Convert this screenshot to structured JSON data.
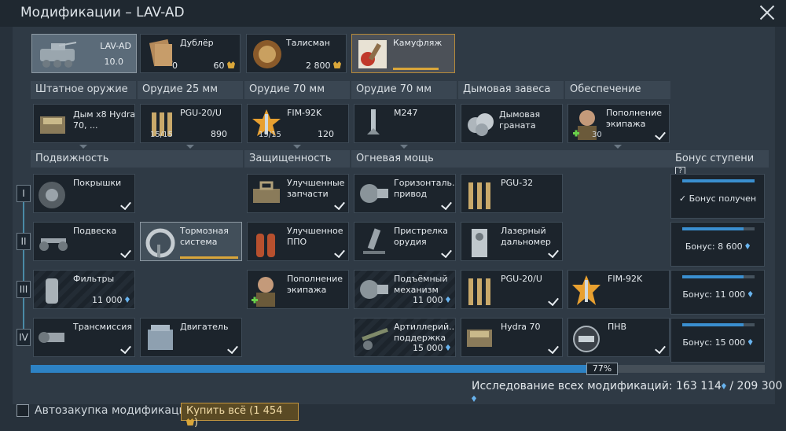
{
  "title": "Модификации – LAV-AD",
  "vehicle": {
    "name": "LAV-AD",
    "br": "10.0"
  },
  "crew": [
    {
      "name": "Дублёр",
      "left": "0",
      "right": "60"
    },
    {
      "name": "Талисман",
      "right": "2 800"
    },
    {
      "name": "Камуфляж"
    }
  ],
  "weapons": [
    {
      "header": "Штатное оружие",
      "item": "Дым x8 Hydra 70, ..."
    },
    {
      "header": "Орудие 25 мм",
      "item": "PGU-20/U",
      "count": "15/15",
      "val": "890"
    },
    {
      "header": "Орудие 70 мм",
      "item": "FIM-92K",
      "count": "15/15",
      "val": "120"
    },
    {
      "header": "Орудие 70 мм",
      "item": "M247"
    },
    {
      "header": "Дымовая завеса",
      "item": "Дымовая граната"
    },
    {
      "header": "Обеспечение",
      "item": "Пополнение экипажа",
      "count": "30"
    }
  ],
  "sections": {
    "mobility": "Подвижность",
    "protection": "Защищенность",
    "firepower": "Огневая мощь",
    "bonus": "Бонус ступени",
    "help": "?"
  },
  "tiers": [
    "I",
    "II",
    "III",
    "IV"
  ],
  "mods": {
    "tyres": "Покрышки",
    "suspension": "Подвеска",
    "brakes": "Тормозная система",
    "filters": "Фильтры",
    "filters_val": "11 000",
    "transmission": "Трансмиссия",
    "engine": "Двигатель",
    "parts": "Улучшенные запчасти",
    "ppo": "Улучшенное ППО",
    "crew_repl": "Пополнение экипажа",
    "horiz": "Горизонталь... привод",
    "pgu32": "PGU-32",
    "adjust": "Пристрелка орудия",
    "laser": "Лазерный дальномер",
    "elev": "Подъёмный механизм",
    "elev_val": "11 000",
    "pgu20": "PGU-20/U",
    "fim": "FIM-92K",
    "arty": "Артиллерий... поддержка",
    "arty_val": "15 000",
    "hydra": "Hydra 70",
    "nvd": "ПНВ"
  },
  "bonus": [
    {
      "text": "Бонус получен",
      "fill": 1.0
    },
    {
      "text": "Бонус: 8 600",
      "fill": 0.85
    },
    {
      "text": "Бонус: 11 000",
      "fill": 0.85
    },
    {
      "text": "Бонус: 15 000",
      "fill": 0.85
    }
  ],
  "progress": {
    "percent": "77%",
    "fraction": 0.77
  },
  "research": {
    "text": "Исследование всех модификаций: 163 114",
    "total": "/ 209 300"
  },
  "auto_label": "Автозакупка модификаций",
  "buy_label": "Купить всё (1 454",
  "buy_suffix": ")",
  "colors": {
    "accent": "#2d82c4",
    "gold": "#c4963f"
  }
}
